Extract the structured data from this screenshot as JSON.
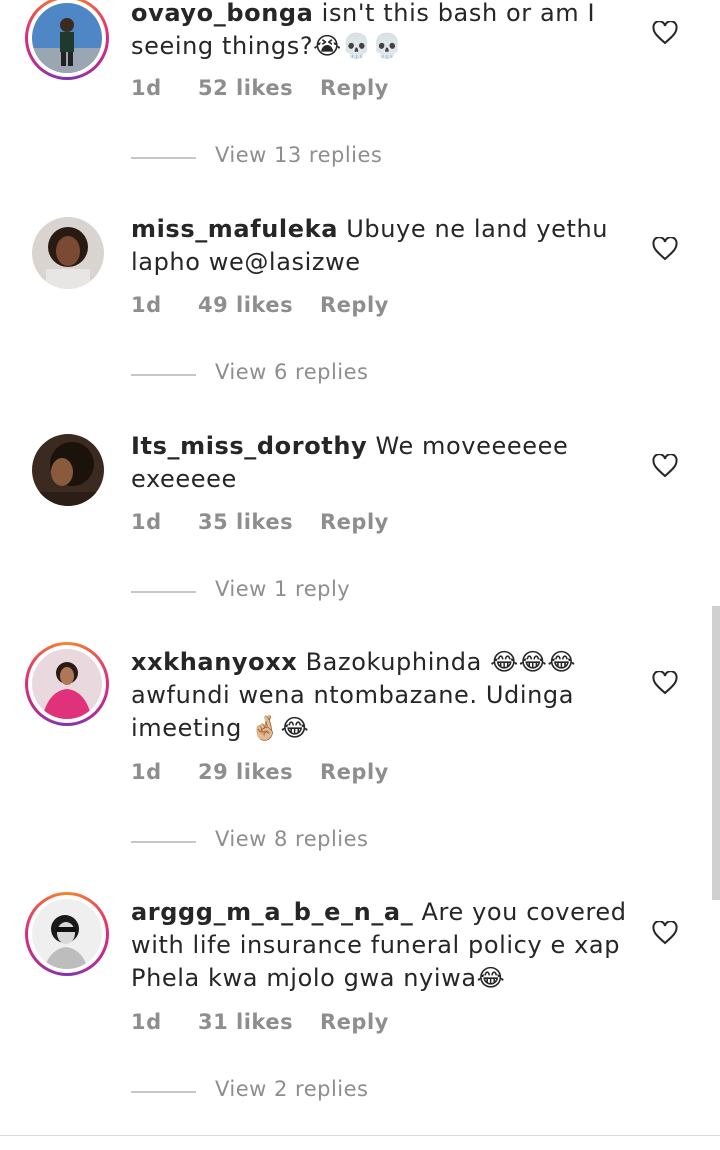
{
  "comments": [
    {
      "username": "ovayo_bonga",
      "text": " isn't this bash or am I seeing things?😭💀💀",
      "time": "1d",
      "likes": "52 likes",
      "reply": "Reply",
      "view_replies": "View 13 replies"
    },
    {
      "username": "miss_mafuleka",
      "text": " Ubuye ne land yethu lapho we@lasizwe",
      "time": "1d",
      "likes": "49 likes",
      "reply": "Reply",
      "view_replies": "View 6 replies"
    },
    {
      "username": "Its_miss_dorothy",
      "text": " We moveeeeee exeeeee",
      "time": "1d",
      "likes": "35 likes",
      "reply": "Reply",
      "view_replies": "View 1 reply"
    },
    {
      "username": "xxkhanyoxx",
      "text": " Bazokuphinda 😂😂😂 awfundi wena ntombazane. Udinga imeeting 🤞🏼😂",
      "time": "1d",
      "likes": "29 likes",
      "reply": "Reply",
      "view_replies": "View 8 replies"
    },
    {
      "username": "arggg_m_a_b_e_n_a_",
      "text": " Are you covered with life insurance funeral policy e xap Phela kwa mjolo gwa nyiwa😂",
      "time": "1d",
      "likes": "31 likes",
      "reply": "Reply",
      "view_replies": "View 2 replies"
    }
  ],
  "icons": {
    "like": "heart-outline-icon"
  },
  "colors": {
    "meta": "#8e8e8e",
    "ring_start": "#f58529",
    "ring_mid": "#dd2a7b"
  }
}
